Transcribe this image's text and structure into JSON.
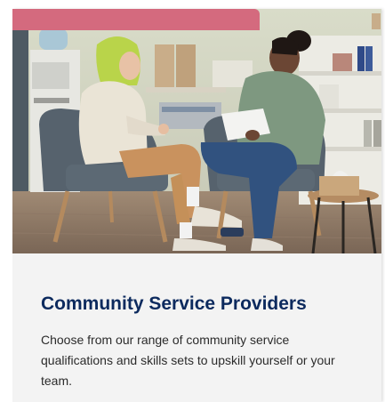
{
  "card": {
    "title": "Community Service Providers",
    "description": "Choose from our range of community service qualifications and skills sets to upskill yourself or your team.",
    "image_semantic": "photo-two-women-consultation",
    "progress": {
      "fraction": 0.67,
      "color": "#d46a7e"
    },
    "colors": {
      "title": "#0c2a5e",
      "text": "#2b2b2b",
      "background": "#f3f3f3"
    }
  }
}
